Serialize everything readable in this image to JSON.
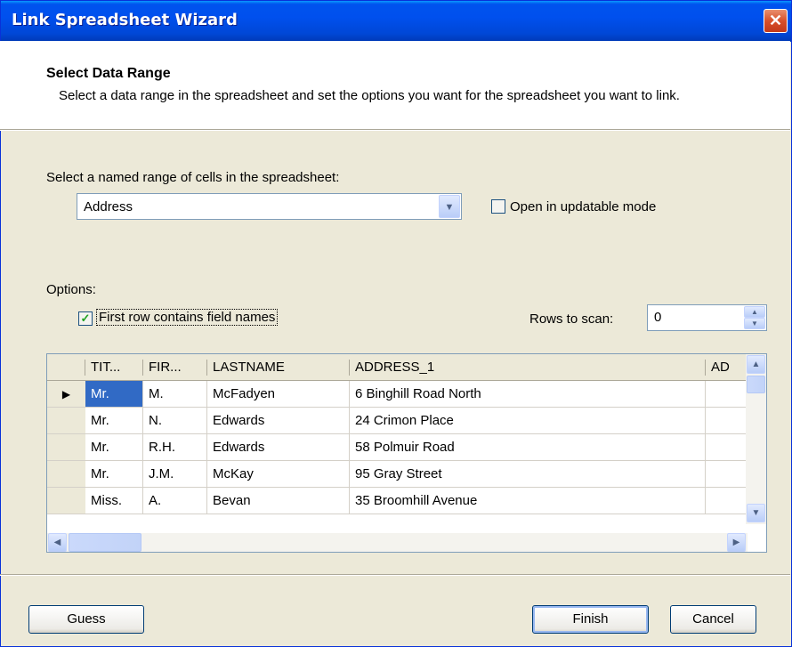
{
  "window": {
    "title": "Link Spreadsheet Wizard",
    "close_glyph": "✕"
  },
  "header": {
    "title": "Select Data Range",
    "description": "Select a data range in the spreadsheet and set the options you want for the spreadsheet you want to link."
  },
  "range": {
    "label": "Select a named range of cells in the spreadsheet:",
    "selected": "Address",
    "updatable_label": "Open in updatable mode",
    "updatable_checked": false
  },
  "options": {
    "label": "Options:",
    "first_row_label": "First row contains field names",
    "first_row_checked": true,
    "rows_to_scan_label": "Rows to scan:",
    "rows_to_scan_value": "0"
  },
  "grid": {
    "columns": [
      "TIT...",
      "FIR...",
      "LASTNAME",
      "ADDRESS_1",
      "AD"
    ],
    "rows": [
      [
        "Mr.",
        "M.",
        "McFadyen",
        "6 Binghill Road North",
        ""
      ],
      [
        "Mr.",
        "N.",
        "Edwards",
        "24 Crimon Place",
        ""
      ],
      [
        "Mr.",
        "R.H.",
        "Edwards",
        "58 Polmuir Road",
        ""
      ],
      [
        "Mr.",
        "J.M.",
        "McKay",
        "95 Gray Street",
        ""
      ],
      [
        "Miss.",
        "A.",
        "Bevan",
        "35 Broomhill Avenue",
        ""
      ]
    ],
    "current_row_indicator": "▶"
  },
  "buttons": {
    "guess": "Guess",
    "finish": "Finish",
    "cancel": "Cancel"
  },
  "colors": {
    "titlebar": "#0053ee",
    "selection": "#316ac5",
    "dialog_bg": "#ece9d8"
  }
}
